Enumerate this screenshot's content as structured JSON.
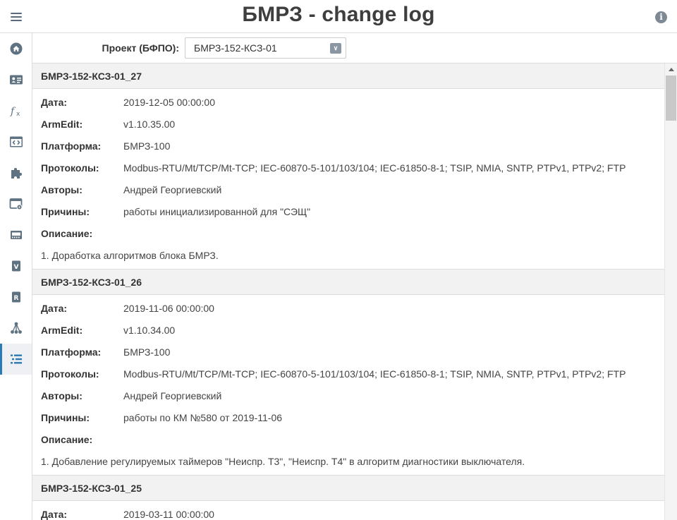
{
  "header": {
    "title": "БМРЗ - change log",
    "menu_icon": "hamburger-menu-icon",
    "info_icon": "info-icon",
    "info_glyph": "i"
  },
  "sidebar": {
    "items": [
      {
        "name": "home",
        "icon": "home-icon",
        "active": false
      },
      {
        "name": "id-card",
        "icon": "id-card-icon",
        "active": false
      },
      {
        "name": "functions",
        "icon": "function-icon",
        "active": false
      },
      {
        "name": "code",
        "icon": "code-window-icon",
        "active": false
      },
      {
        "name": "plugins",
        "icon": "puzzle-icon",
        "active": false
      },
      {
        "name": "window-settings",
        "icon": "window-gear-icon",
        "active": false
      },
      {
        "name": "hardware",
        "icon": "board-icon",
        "active": false
      },
      {
        "name": "v",
        "icon": "v-badge-icon",
        "active": false
      },
      {
        "name": "r",
        "icon": "r-badge-icon",
        "active": false
      },
      {
        "name": "network",
        "icon": "network-icon",
        "active": false
      },
      {
        "name": "change-log",
        "icon": "list-icon",
        "active": true
      }
    ]
  },
  "filter": {
    "label": "Проект (БФПО):",
    "selected": "БМРЗ-152-КСЗ-01",
    "arrow_glyph": "∨"
  },
  "labels": {
    "date": "Дата:",
    "armedit": "ArmEdit:",
    "platform": "Платформа:",
    "protocols": "Протоколы:",
    "authors": "Авторы:",
    "reasons": "Причины:",
    "description": "Описание:"
  },
  "entries": [
    {
      "title": "БМРЗ-152-КСЗ-01_27",
      "date": "2019-12-05 00:00:00",
      "armedit": "v1.10.35.00",
      "platform": "БМРЗ-100",
      "protocols": "Modbus-RTU/Mt/TCP/Mt-TCP; IEC-60870-5-101/103/104; IEC-61850-8-1; TSIP, NMIA, SNTP, PTPv1, PTPv2; FTP",
      "authors": "Андрей Георгиевский",
      "reasons": "работы инициализированной для \"СЭЩ\"",
      "description": "1. Доработка алгоритмов блока БМРЗ."
    },
    {
      "title": "БМРЗ-152-КСЗ-01_26",
      "date": "2019-11-06 00:00:00",
      "armedit": "v1.10.34.00",
      "platform": "БМРЗ-100",
      "protocols": "Modbus-RTU/Mt/TCP/Mt-TCP; IEC-60870-5-101/103/104; IEC-61850-8-1; TSIP, NMIA, SNTP, PTPv1, PTPv2; FTP",
      "authors": "Андрей Георгиевский",
      "reasons": "работы по КМ №580 от 2019-11-06",
      "description": "1. Добавление регулируемых таймеров \"Неиспр. Т3\", \"Неиспр. Т4\" в алгоритм диагностики выключателя."
    },
    {
      "title": "БМРЗ-152-КСЗ-01_25",
      "date": "2019-03-11 00:00:00"
    }
  ]
}
